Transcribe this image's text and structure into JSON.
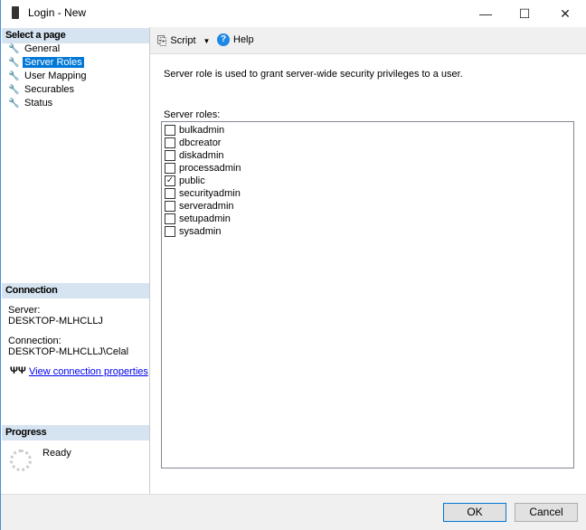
{
  "window": {
    "title": "Login - New",
    "minimize": "—",
    "maximize": "☐",
    "close": "✕"
  },
  "left": {
    "select_page_header": "Select a page",
    "pages": [
      {
        "label": "General"
      },
      {
        "label": "Server Roles",
        "selected": true
      },
      {
        "label": "User Mapping"
      },
      {
        "label": "Securables"
      },
      {
        "label": "Status"
      }
    ],
    "connection_header": "Connection",
    "server_label": "Server:",
    "server_value": "DESKTOP-MLHCLLJ",
    "connection_label": "Connection:",
    "connection_value": "DESKTOP-MLHCLLJ\\Celal",
    "view_link": "View connection properties",
    "progress_header": "Progress",
    "progress_status": "Ready"
  },
  "toolbar": {
    "script": "Script",
    "help": "Help"
  },
  "main": {
    "description": "Server role is used to grant server-wide security privileges to a user.",
    "roles_label": "Server roles:",
    "roles": [
      {
        "name": "bulkadmin",
        "checked": false
      },
      {
        "name": "dbcreator",
        "checked": false
      },
      {
        "name": "diskadmin",
        "checked": false
      },
      {
        "name": "processadmin",
        "checked": false
      },
      {
        "name": "public",
        "checked": true
      },
      {
        "name": "securityadmin",
        "checked": false
      },
      {
        "name": "serveradmin",
        "checked": false
      },
      {
        "name": "setupadmin",
        "checked": false
      },
      {
        "name": "sysadmin",
        "checked": false
      }
    ]
  },
  "buttons": {
    "ok": "OK",
    "cancel": "Cancel"
  }
}
